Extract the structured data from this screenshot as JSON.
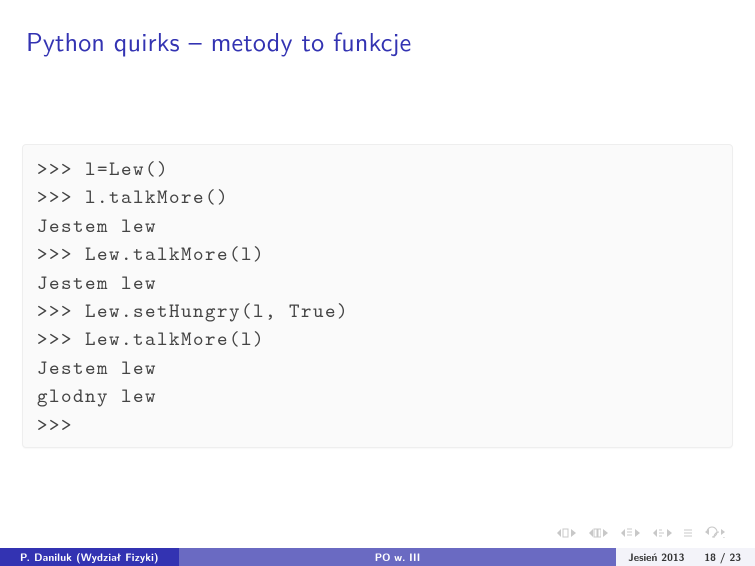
{
  "title": "Python quirks – metody to funkcje",
  "code": {
    "l0": ">>> l=Lew()",
    "l1": ">>> l.talkMore()",
    "l2": "Jestem lew",
    "l3": ">>> Lew.talkMore(l)",
    "l4": "Jestem lew",
    "l5": ">>> Lew.setHungry(l, True)",
    "l6": ">>> Lew.talkMore(l)",
    "l7": "Jestem lew",
    "l8": "glodny lew",
    "l9": ">>>"
  },
  "footer": {
    "author": "P. Daniluk (Wydział Fizyki)",
    "mid": "PO w. III",
    "date": "Jesień 2013",
    "page": "18 / 23"
  },
  "nav": {
    "first_icon": "first-slide-icon",
    "prev_icon": "prev-slide-icon",
    "next_icon": "next-slide-icon",
    "last_icon": "last-slide-icon",
    "undo_icon": "undo-icon",
    "mode_icon": "mode-icon"
  }
}
